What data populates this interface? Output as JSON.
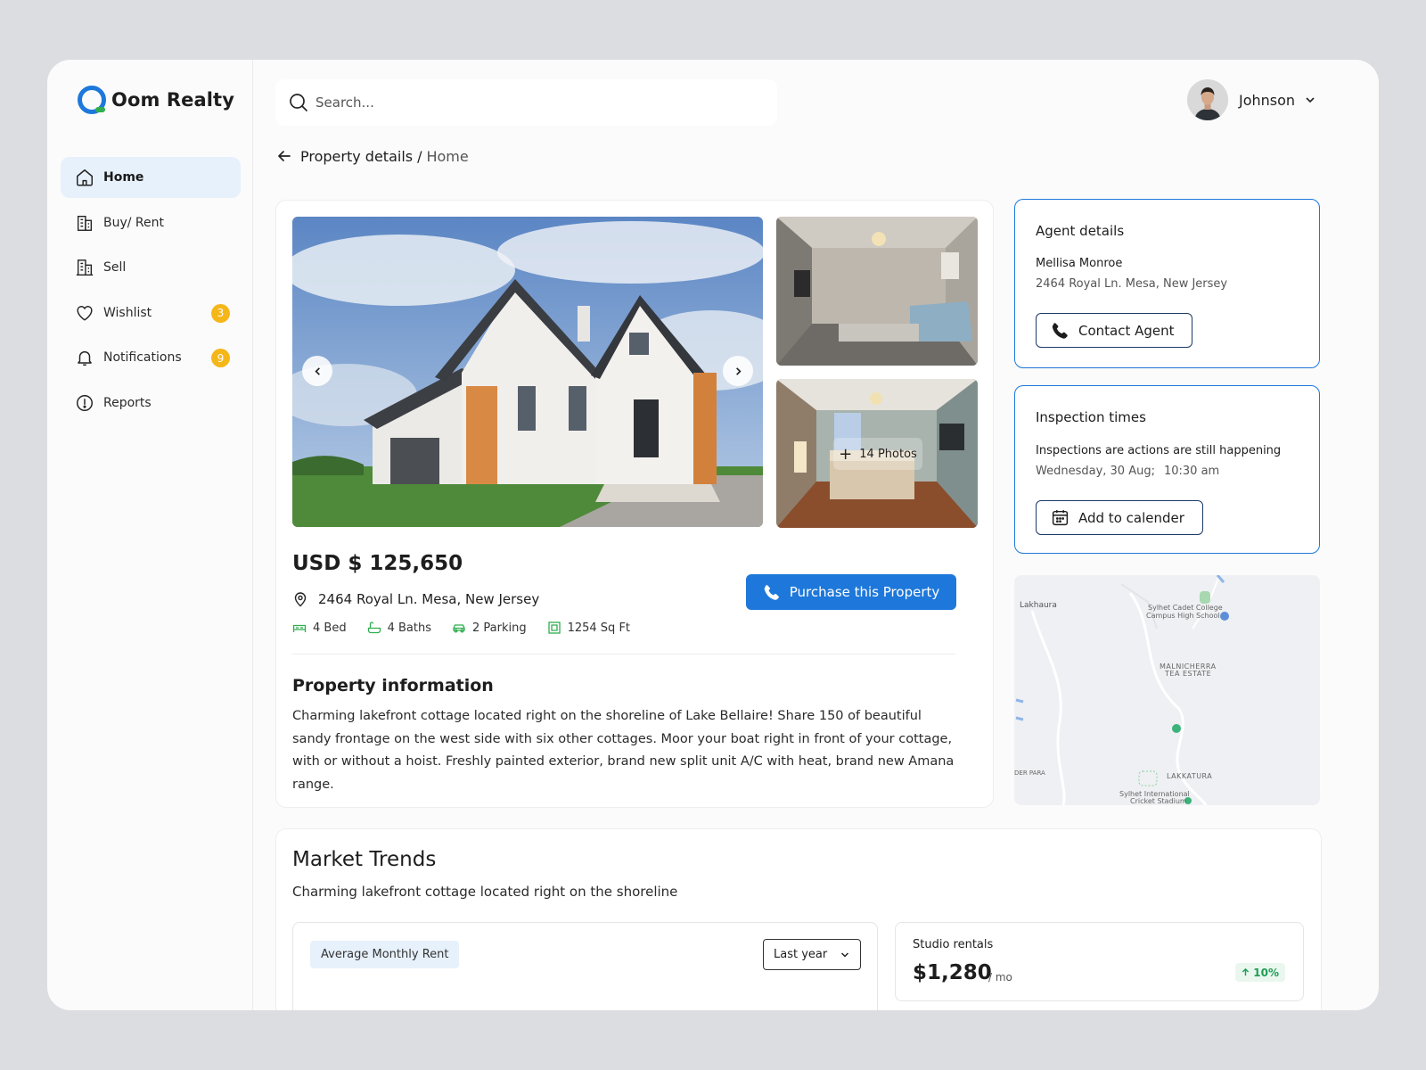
{
  "brand": {
    "name": "Oom Realty"
  },
  "sidebar": {
    "items": [
      {
        "label": "Home",
        "icon": "home-icon"
      },
      {
        "label": "Buy/ Rent",
        "icon": "building-icon"
      },
      {
        "label": "Sell",
        "icon": "office-icon"
      },
      {
        "label": "Wishlist",
        "icon": "heart-icon",
        "badge": "3"
      },
      {
        "label": "Notifications",
        "icon": "bell-icon",
        "badge": "9"
      },
      {
        "label": "Reports",
        "icon": "alert-circle-icon"
      }
    ]
  },
  "header": {
    "search_placeholder": "Search...",
    "user_name": "Johnson"
  },
  "breadcrumb": {
    "main": "Property details",
    "separator": "/",
    "sub": "Home"
  },
  "property": {
    "more_photos_count": "14",
    "more_photos_label": "Photos",
    "price": "USD $ 125,650",
    "address": "2464 Royal Ln. Mesa, New Jersey",
    "features": {
      "bed": "4 Bed",
      "baths": "4 Baths",
      "parking": "2 Parking",
      "area": "1254 Sq Ft"
    },
    "purchase_label": "Purchase this Property",
    "info_title": "Property information",
    "info_text": "Charming lakefront cottage located right on the shoreline of Lake Bellaire! Share 150 of beautiful sandy frontage on the west side with six other cottages. Moor your boat right in front of your cottage, with or without a hoist. Freshly painted exterior, brand new split unit A/C with heat, brand new Amana range."
  },
  "agent": {
    "title": "Agent details",
    "name": "Mellisa Monroe",
    "address": "2464 Royal Ln. Mesa, New Jersey",
    "contact_label": "Contact Agent"
  },
  "inspection": {
    "title": "Inspection times",
    "status": "Inspections are actions are still happening",
    "date": "Wednesday, 30 Aug;",
    "time": "10:30 am",
    "calendar_label": "Add to calender"
  },
  "map": {
    "labels": {
      "lakhaura": "Lakhaura",
      "school_1": "Sylhet Cadet College",
      "school_2": "Campus High School",
      "tea_1": "MALNICHERRA",
      "tea_2": "TEA ESTATE",
      "lakkatura": "LAKKATURA",
      "para": "DER PARA",
      "stadium_1": "Sylhet International",
      "stadium_2": "Cricket Stadium"
    }
  },
  "market": {
    "title": "Market Trends",
    "subtitle": "Charming lakefront cottage located right on the shoreline",
    "rent_tag": "Average Monthly Rent",
    "period": "Last year",
    "studio_title": "Studio rentals",
    "studio_price": "$1,280",
    "studio_unit": "/ mo",
    "studio_growth": "10%"
  },
  "colors": {
    "accent": "#1e78db",
    "badge": "#f5b619",
    "positive": "#1e9e55",
    "active_bg": "#e7f1fc",
    "feature_icon": "#2fae4f"
  }
}
